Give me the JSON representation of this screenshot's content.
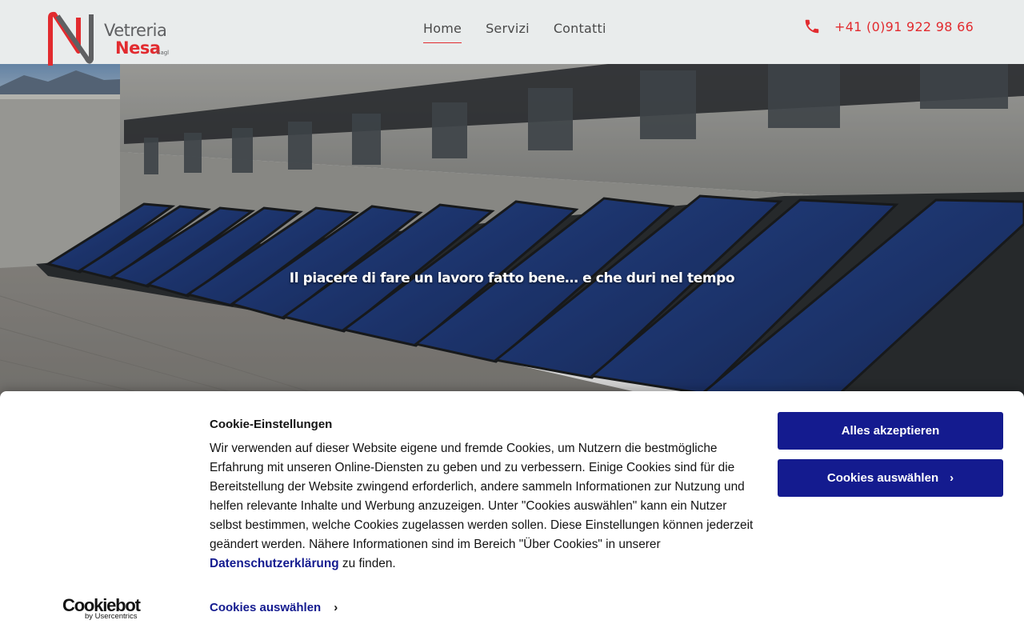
{
  "brand": {
    "line1": "Vetreria",
    "line2": "Nesa",
    "line3": "Sagl",
    "red": "#e22b2f",
    "grey": "#5f6062"
  },
  "nav": {
    "items": [
      {
        "label": "Home",
        "active": true
      },
      {
        "label": "Servizi",
        "active": false
      },
      {
        "label": "Contatti",
        "active": false
      }
    ]
  },
  "phone": {
    "icon": "phone-icon",
    "number": "+41 (0)91 922 98 66"
  },
  "hero": {
    "tagline": "Il piacere di fare un lavoro fatto bene… e che duri nel tempo"
  },
  "cookie": {
    "title": "Cookie-Einstellungen",
    "text_before_link": "Wir verwenden auf dieser Website eigene und fremde Cookies, um Nutzern die bestmögliche Erfahrung mit unseren Online-Diensten zu geben und zu verbessern. Einige Cookies sind für die Bereitstellung der Website zwingend erforderlich, andere sammeln Informationen zur Nutzung und helfen relevante Inhalte und Werbung anzuzeigen. Unter \"Cookies auswählen\" kann ein Nutzer selbst bestimmen, welche Cookies zugelassen werden sollen. Diese Einstellungen können jederzeit geändert werden. Nähere Informationen sind im Bereich \"Über Cookies\" in unserer",
    "link_label": "Datenschutzerklärung",
    "text_after_link": " zu finden.",
    "accept_label": "Alles akzeptieren",
    "select_label": "Cookies auswählen",
    "details_label": "Cookies auswählen",
    "button_color": "#141b8f"
  },
  "cookiebot": {
    "name": "Cookiebot",
    "by": "by Usercentrics"
  }
}
